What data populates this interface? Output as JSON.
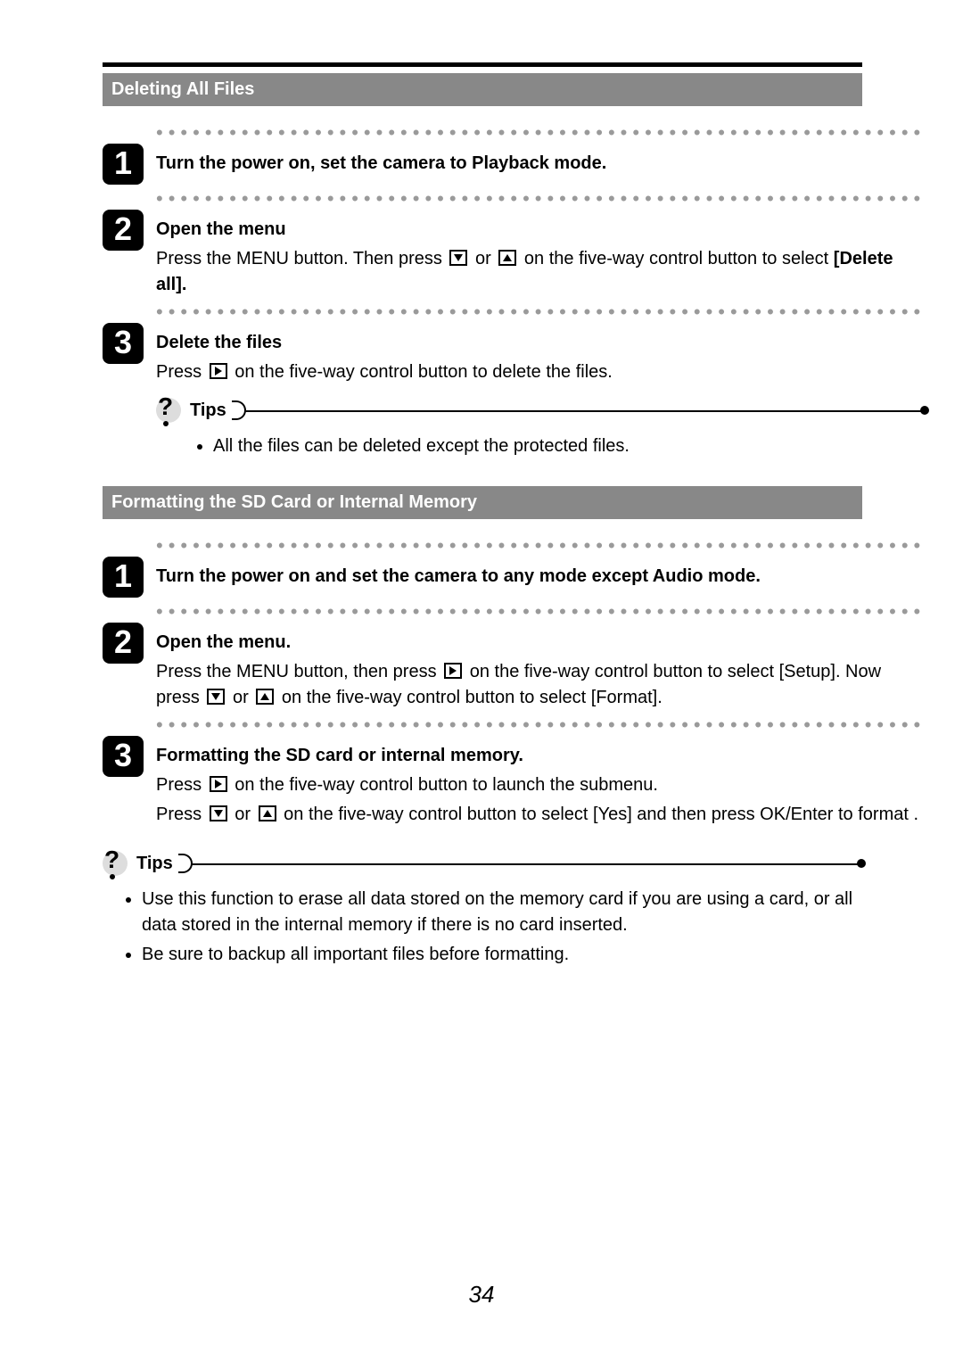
{
  "page_number": "34",
  "icons": {
    "down": "down-triangle",
    "up": "up-triangle",
    "right": "right-triangle",
    "tips_mark": "question-mark"
  },
  "section1": {
    "title": "Deleting All Files",
    "steps": [
      {
        "num": "1",
        "title": "Turn the power on, set the camera to Playback mode."
      },
      {
        "num": "2",
        "title": "Open the menu",
        "text_pre_icons": "Press the MENU button. Then press ",
        "text_mid": " or ",
        "text_post_icons_a": " on the five-way control button to select ",
        "bold_tail": "[Delete all]."
      },
      {
        "num": "3",
        "title": "Delete the files",
        "text_pre": "Press ",
        "text_post": " on the five-way control button to delete the files."
      }
    ],
    "tips_label": "Tips",
    "tips_items": [
      "All the files can be deleted except the protected files."
    ]
  },
  "section2": {
    "title": "Formatting the SD Card or Internal Memory",
    "steps": [
      {
        "num": "1",
        "title": "Turn the power on and set the camera to any mode except Audio mode."
      },
      {
        "num": "2",
        "title": "Open the menu",
        "title_suffix": ".",
        "line2_pre": "Press the MENU button, then press ",
        "line2_post": " on the five-way control button to select [Setup]. Now press ",
        "line2_mid": " or ",
        "line2_end": " on the five-way control button to select [Format]."
      },
      {
        "num": "3",
        "title": "Formatting the SD card or internal memory",
        "title_suffix": ".",
        "line3a_pre": "Press ",
        "line3a_post": " on the five-way control button to launch the submenu.",
        "line3b_pre": "Press ",
        "line3b_mid": " or ",
        "line3b_post": " on the five-way control button to select [Yes] and then press OK/Enter to format ."
      }
    ],
    "tips_label": "Tips",
    "tips_items": [
      "Use this function to erase all data stored on the memory card if you are using a card, or all data stored in the internal memory if there is no card inserted.",
      "Be sure to backup all important files before formatting."
    ]
  }
}
